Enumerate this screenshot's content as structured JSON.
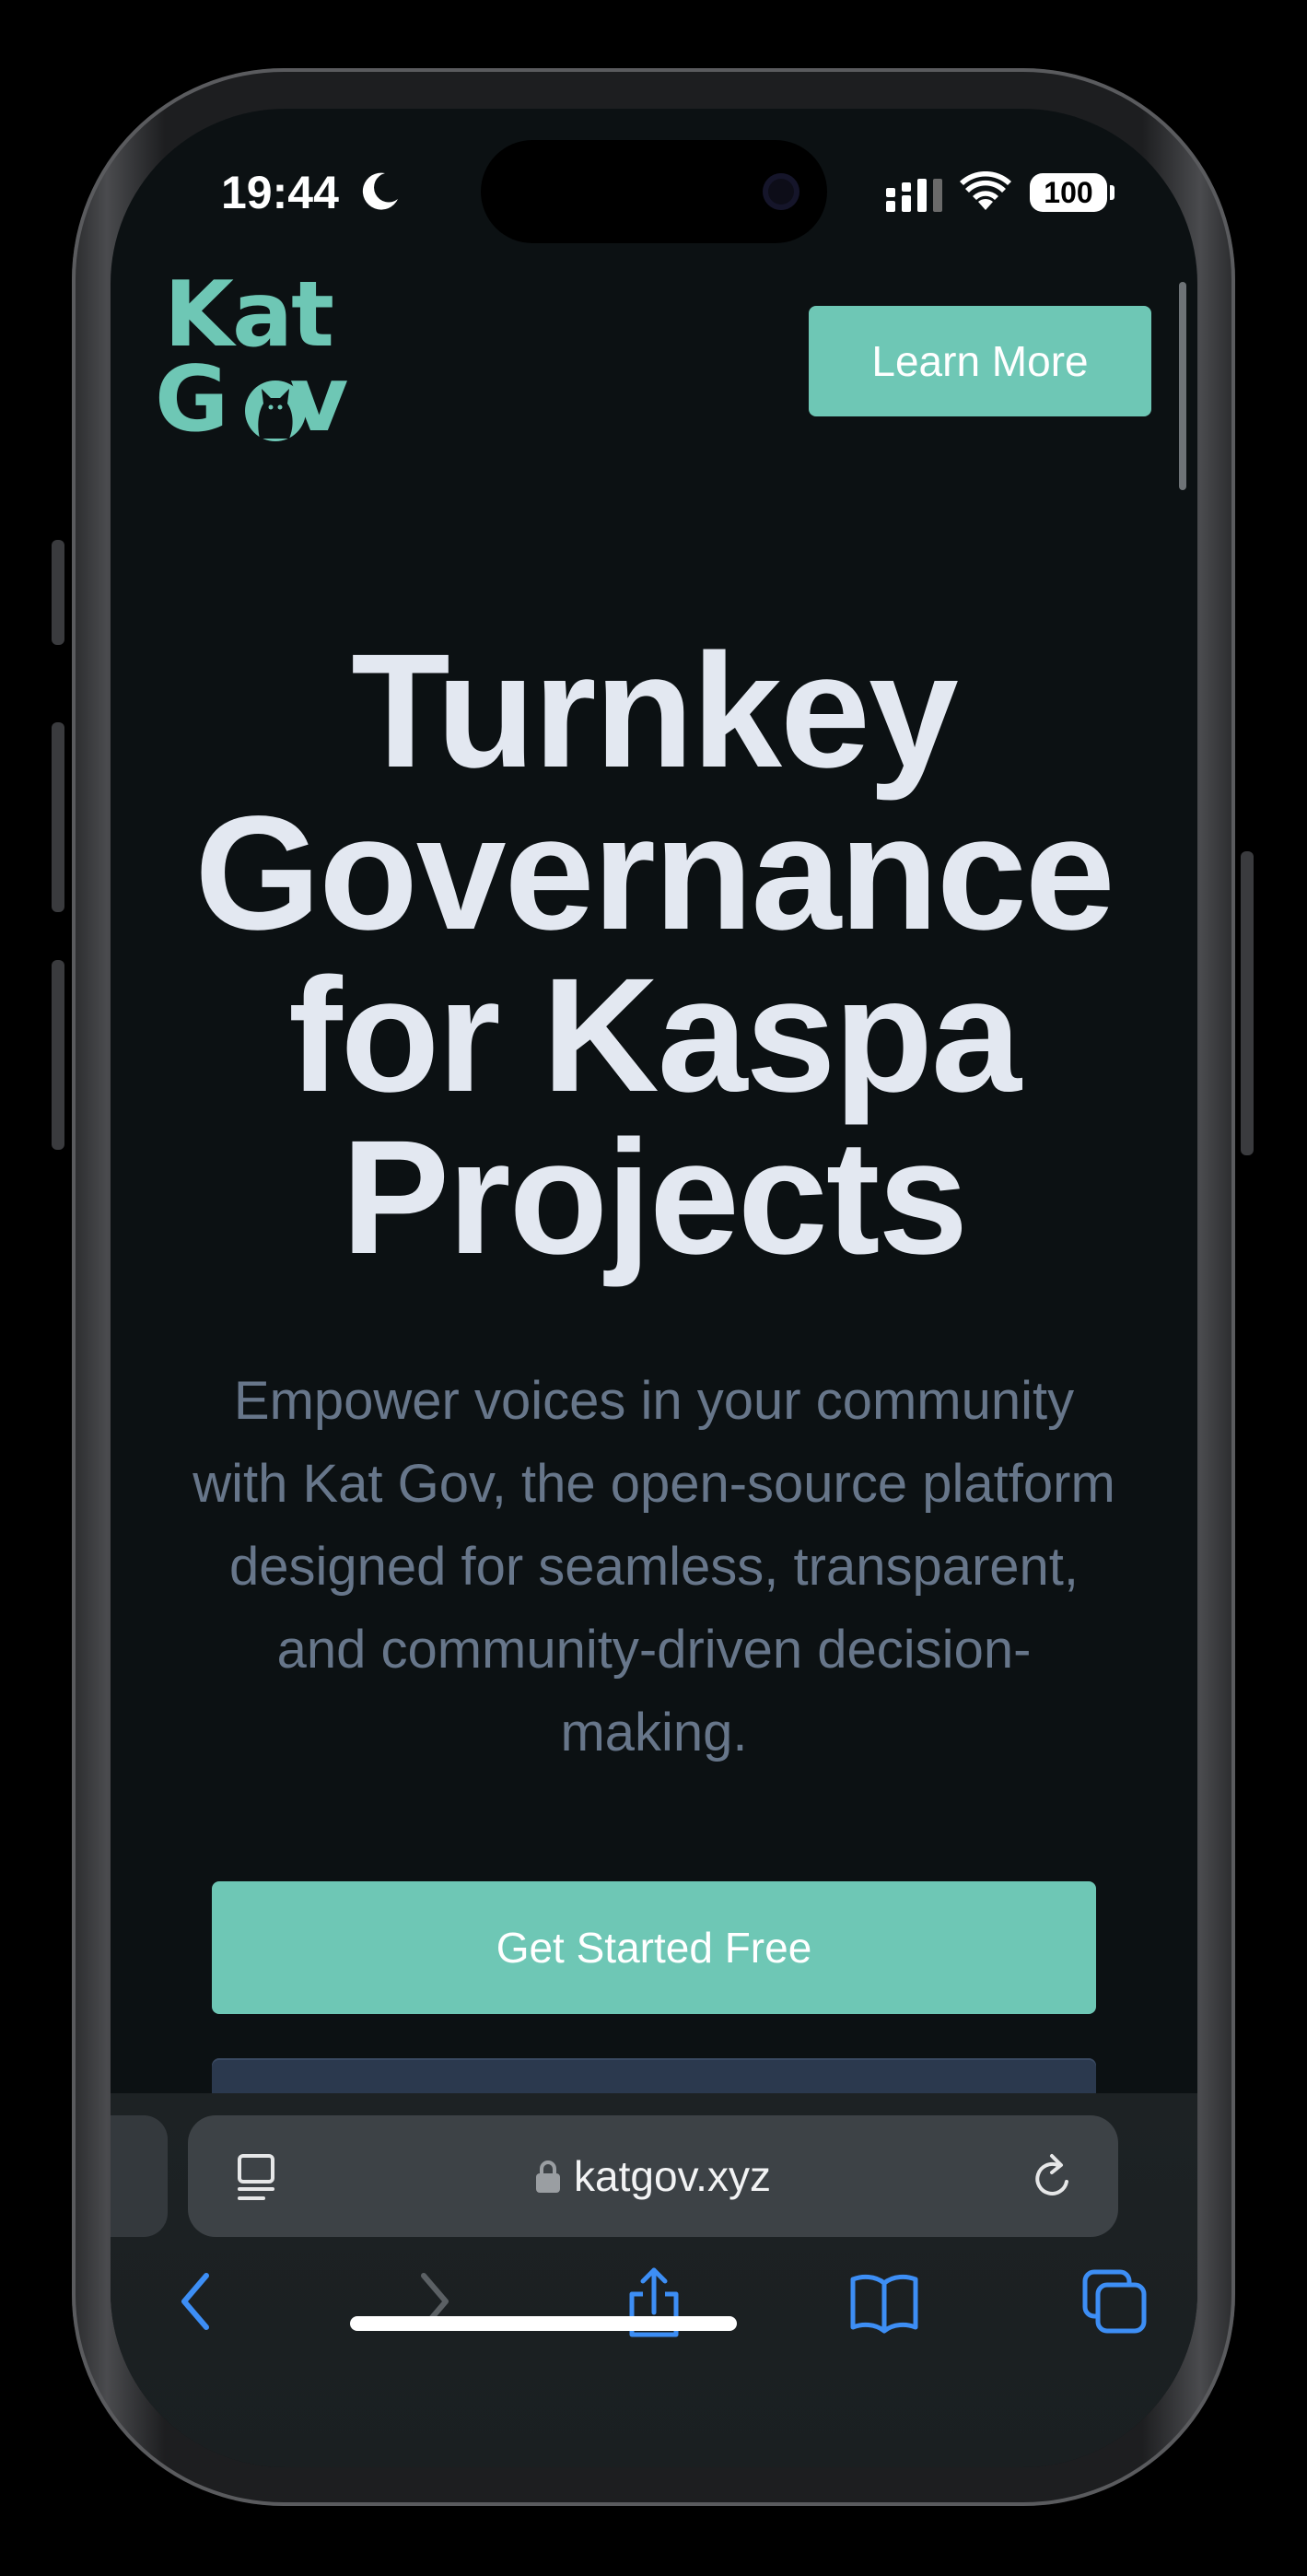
{
  "status_bar": {
    "time": "19:44",
    "battery": "100"
  },
  "header": {
    "logo_line1": "Kat",
    "logo_line2_a": "G",
    "logo_line2_b": "v",
    "learn_more_label": "Learn More"
  },
  "hero": {
    "line1": "Turnkey",
    "line2": "Governance",
    "line3": "for Kaspa",
    "line4": "Projects",
    "subtitle_line1": "Empower voices in your community",
    "subtitle_line2": "with Kat Gov, the open-source platform",
    "subtitle_line3": "designed for seamless, transparent,",
    "subtitle_line4": "and community-driven decision-",
    "subtitle_line5": "making.",
    "cta_label": "Get Started Free"
  },
  "browser": {
    "url": "katgov.xyz"
  },
  "colors": {
    "accent": "#6ec7b5",
    "background": "#0c1113",
    "hero_text": "#e3e8f1",
    "subtitle_text": "#67768a",
    "ios_blue": "#3d8ef5"
  },
  "icons": [
    "moon-icon",
    "signal-icon",
    "wifi-icon",
    "cat-icon",
    "reader-icon",
    "lock-icon",
    "reload-icon",
    "back-icon",
    "forward-icon",
    "share-icon",
    "bookmarks-icon",
    "tabs-icon"
  ]
}
